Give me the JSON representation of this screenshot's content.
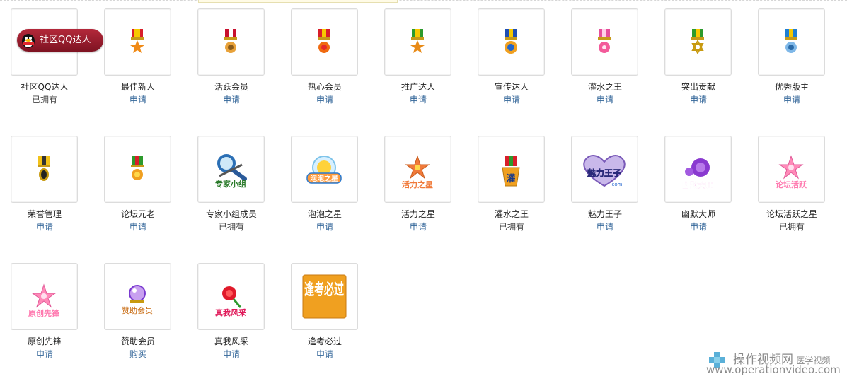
{
  "medals": [
    {
      "name": "社区QQ达人",
      "status": "已拥有",
      "owned": true,
      "icon": "qq-pill-icon",
      "pill_text": "社区QQ达人"
    },
    {
      "name": "最佳新人",
      "status": "申请",
      "owned": false,
      "icon": "medal-orange-star-icon"
    },
    {
      "name": "活跃会员",
      "status": "申请",
      "owned": false,
      "icon": "medal-red-flower-icon"
    },
    {
      "name": "热心会员",
      "status": "申请",
      "owned": false,
      "icon": "medal-red-sun-icon"
    },
    {
      "name": "推广达人",
      "status": "申请",
      "owned": false,
      "icon": "medal-green-star-icon"
    },
    {
      "name": "宣传达人",
      "status": "申请",
      "owned": false,
      "icon": "medal-blue-sun-icon"
    },
    {
      "name": "灌水之王",
      "status": "申请",
      "owned": false,
      "icon": "medal-pink-flower-icon"
    },
    {
      "name": "突出贡献",
      "status": "申请",
      "owned": false,
      "icon": "medal-green-hexagram-icon"
    },
    {
      "name": "优秀版主",
      "status": "申请",
      "owned": false,
      "icon": "medal-blue-gem-icon"
    },
    {
      "name": "荣誉管理",
      "status": "申请",
      "owned": false,
      "icon": "medal-gold-black-icon"
    },
    {
      "name": "论坛元老",
      "status": "申请",
      "owned": false,
      "icon": "medal-gold-green-icon"
    },
    {
      "name": "专家小组成员",
      "status": "已拥有",
      "owned": true,
      "icon": "magnifier-expert-icon",
      "badge_text": "专家小组"
    },
    {
      "name": "泡泡之星",
      "status": "申请",
      "owned": false,
      "icon": "bubble-star-icon",
      "badge_text": "泡泡之星"
    },
    {
      "name": "活力之星",
      "status": "申请",
      "owned": false,
      "icon": "vitality-star-icon",
      "badge_text": "活力之星"
    },
    {
      "name": "灌水之王",
      "status": "已拥有",
      "owned": true,
      "icon": "flood-king-icon",
      "badge_text": "灌"
    },
    {
      "name": "魅力王子",
      "status": "申请",
      "owned": false,
      "icon": "charm-prince-heart-icon",
      "badge_text": "魅力王子",
      "badge_sub": "com"
    },
    {
      "name": "幽默大师",
      "status": "申请",
      "owned": false,
      "icon": "humor-master-rose-icon",
      "badge_text": "幽默大师"
    },
    {
      "name": "论坛活跃之星",
      "status": "已拥有",
      "owned": true,
      "icon": "forum-active-star-flower-icon",
      "badge_text": "论坛活跃"
    },
    {
      "name": "原创先锋",
      "status": "申请",
      "owned": false,
      "icon": "original-pioneer-flower-icon",
      "badge_text": "原创先锋"
    },
    {
      "name": "赞助会员",
      "status": "购买",
      "owned": false,
      "icon": "sponsor-crystal-icon",
      "badge_text": "赞助会员"
    },
    {
      "name": "真我风采",
      "status": "申请",
      "owned": false,
      "icon": "true-self-rose-icon",
      "badge_text": "真我风采"
    },
    {
      "name": "逢考必过",
      "status": "申请",
      "owned": false,
      "icon": "exam-pass-tile-icon",
      "badge_text": "逢考必过"
    }
  ],
  "watermark": {
    "title": "操作视频网",
    "subtitle": "-医学视频",
    "url": "www.operationvideo.com"
  },
  "colors": {
    "apply_link": "#336699",
    "owned_text": "#444444",
    "box_border": "#dcdcdc"
  }
}
